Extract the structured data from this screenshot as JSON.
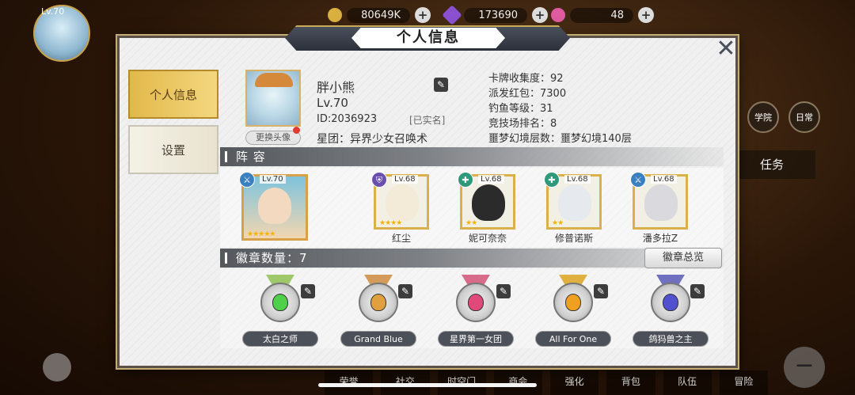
{
  "hud": {
    "level": "Lv.70",
    "gold": "80649K",
    "gems": "173690",
    "energy": "48",
    "task_label": "任务",
    "side_btn_1": "学院",
    "side_btn_2": "日常",
    "bottom_nav": [
      "荣誉",
      "社交",
      "时空门",
      "商会",
      "强化",
      "背包",
      "队伍",
      "冒险"
    ]
  },
  "dialog": {
    "title": "个人信息",
    "tabs": [
      {
        "label": "个人信息",
        "active": true
      },
      {
        "label": "设置",
        "active": false
      }
    ],
    "profile": {
      "name": "胖小熊",
      "level": "Lv.70",
      "id": "ID:2036923",
      "verified": "[已实名]",
      "guild": "星团：异界少女召唤术",
      "change_avatar": "更换头像"
    },
    "stats": [
      "卡牌收集度：92",
      "派发红包：7300",
      "钓鱼等级：31",
      "竞技场排名：8",
      "噩梦幻境层数：噩梦幻境140层"
    ],
    "team_title": "阵 容",
    "team": [
      {
        "name": "",
        "level": "Lv.70",
        "stars": "★★★★★",
        "class_color": "#3a7fc0"
      },
      {
        "name": "红尘",
        "level": "Lv.68",
        "stars": "★★★★",
        "class_color": "#6a4fb0"
      },
      {
        "name": "妮可奈奈",
        "level": "Lv.68",
        "stars": "★★",
        "class_color": "#2f9a7a"
      },
      {
        "name": "修普诺斯",
        "level": "Lv.68",
        "stars": "★★",
        "class_color": "#2f9a7a"
      },
      {
        "name": "潘多拉Z",
        "level": "Lv.68",
        "stars": "",
        "class_color": "#3a7fc0"
      }
    ],
    "badge_title": "徽章数量：7",
    "badge_total_button": "徽章总览",
    "badges": [
      {
        "name": "太白之师",
        "gem_color": "#4fcf4a",
        "ribbon_color": "#9fc86a"
      },
      {
        "name": "Grand Blue",
        "gem_color": "#e0a040",
        "ribbon_color": "#d49a5a"
      },
      {
        "name": "星界第一女团",
        "gem_color": "#e04a7a",
        "ribbon_color": "#d86a8a"
      },
      {
        "name": "All For One",
        "gem_color": "#f0a020",
        "ribbon_color": "#e0b040"
      },
      {
        "name": "鸽犸兽之主",
        "gem_color": "#5050d0",
        "ribbon_color": "#7070c0"
      }
    ]
  }
}
